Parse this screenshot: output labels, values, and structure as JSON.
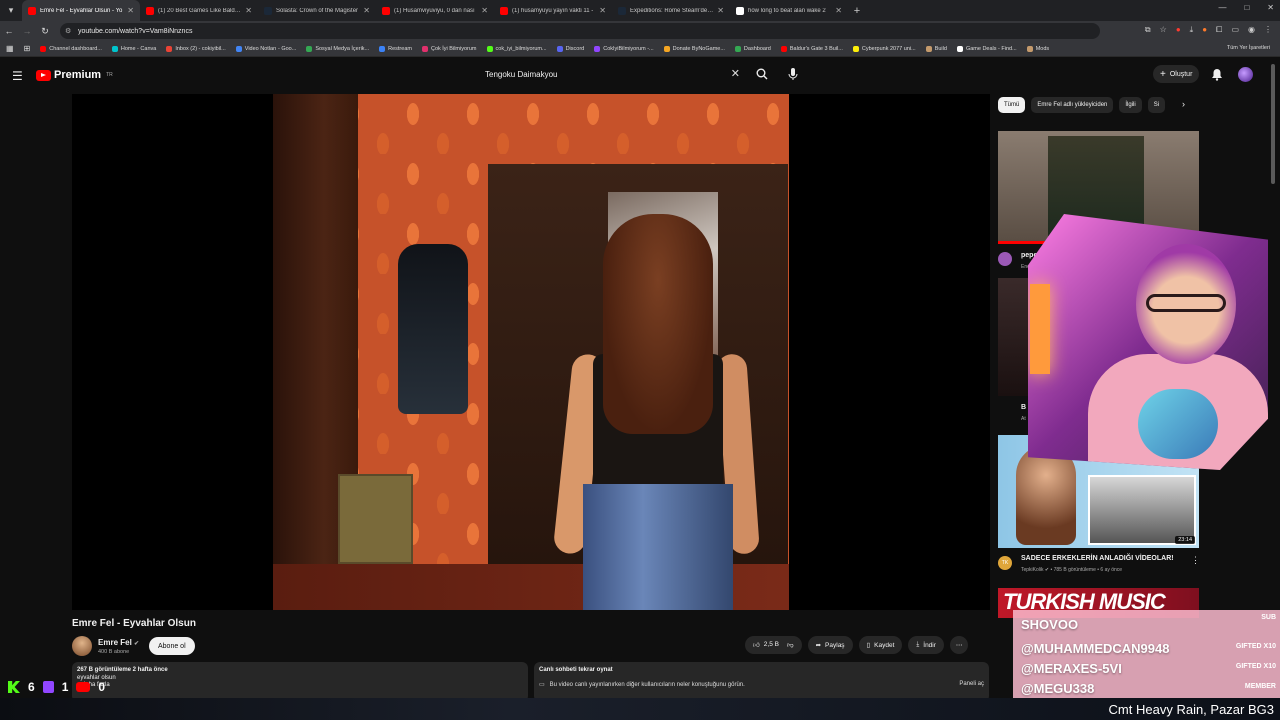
{
  "browser": {
    "tabs": [
      {
        "title": "Emre Fel - Eyvahlar Olsun - Yo",
        "color": "#ff0000",
        "active": true
      },
      {
        "title": "(1) 20 Best Games Like Baldur's",
        "color": "#ff0000"
      },
      {
        "title": "Solasta: Crown of the Magister",
        "color": "#1b2838"
      },
      {
        "title": "(1) Husamviyuviyu, 0 dan nası",
        "color": "#ff0000"
      },
      {
        "title": "(1) husamyuyu yayın vakti 11 -",
        "color": "#ff0000"
      },
      {
        "title": "Expeditions: Rome Steam'de %",
        "color": "#1b2838"
      },
      {
        "title": "how long to beat alan wake 2",
        "color": "#ffffff"
      }
    ],
    "url": "youtube.com/watch?v=Vam8iNnzncs",
    "bookmarks": [
      {
        "label": "Channel dashboard...",
        "color": "#ff0000"
      },
      {
        "label": "Home - Canva",
        "color": "#00c4cc"
      },
      {
        "label": "Inbox (2) - cokiyibil...",
        "color": "#ea4335"
      },
      {
        "label": "Video Notları - Goo...",
        "color": "#4285f4"
      },
      {
        "label": "Sosyal Medya İçerik...",
        "color": "#34a853"
      },
      {
        "label": "Restream",
        "color": "#3b82f6"
      },
      {
        "label": "Çok İyi Bilmiyorum",
        "color": "#e1306c"
      },
      {
        "label": "cok_iyi_bilmiyorum...",
        "color": "#53fc18"
      },
      {
        "label": "Discord",
        "color": "#5865f2"
      },
      {
        "label": "CokIyiBilmiyorum -...",
        "color": "#9146ff"
      },
      {
        "label": "Donate ByNoGame...",
        "color": "#f5a623"
      },
      {
        "label": "Dashboard",
        "color": "#34a853"
      },
      {
        "label": "Baldur's Gate 3 Buil...",
        "color": "#ff0000"
      },
      {
        "label": "Cyberpunk 2077 uni...",
        "color": "#fcee0a"
      },
      {
        "label": "Build",
        "color": "#c49a6c"
      },
      {
        "label": "Game Deals - Find...",
        "color": "#ffffff"
      },
      {
        "label": "Mods",
        "color": "#c49a6c"
      }
    ],
    "all_bookmarks": "Tüm Yer İşaretleri"
  },
  "youtube": {
    "logo": "Premium",
    "logo_region": "TR",
    "search_value": "Tengoku Daimakyou",
    "create_label": "Oluştur",
    "video": {
      "title": "Emre Fel - Eyvahlar Olsun",
      "channel": "Emre Fel",
      "subscribers": "400 B abone",
      "subscribe_label": "Abone ol",
      "likes": "2,5 B",
      "share": "Paylaş",
      "save": "Kaydet",
      "download": "İndir",
      "views_date": "267 B görüntüleme  2 hafta önce",
      "desc_line": "eyvahlar olsun",
      "more": "...daha fazla"
    },
    "live_chat": {
      "title": "Canlı sohbeti tekrar oynat",
      "text": "Bu video canlı yayınlanırken diğer kullanıcıların neler konuştuğunu görün.",
      "button": "Paneli aç"
    },
    "chips": [
      {
        "label": "Tümü",
        "active": true
      },
      {
        "label": "Emre Fel adlı yükleyiciden"
      },
      {
        "label": "İlgili"
      },
      {
        "label": "Si"
      }
    ],
    "recommendations": [
      {
        "title": "pepee iki ekm",
        "channel": "Enes Dem"
      },
      {
        "title": "B",
        "channel": "At"
      },
      {
        "title": "SADECE ERKEKLERİN ANLADIĞI VİDEOLAR!",
        "channel": "TepkiKolik",
        "meta": "785 B görüntüleme • 6 ay önce",
        "duration": "23:14",
        "badge": "TK"
      },
      {
        "title": "TURKISH MUSIC"
      }
    ]
  },
  "stream_overlay": {
    "sub_label": "SUB",
    "events": [
      {
        "name": "SHOVOO",
        "tag": ""
      },
      {
        "name": "@MUHAMMEDCAN9948",
        "tag": "GIFTED X10"
      },
      {
        "name": "@MERAXES-5VI",
        "tag": "GIFTED X10"
      },
      {
        "name": "@MEGU338",
        "tag": "MEMBER"
      }
    ],
    "kick_count": "6",
    "twitch_count": "1",
    "youtube_count": "0",
    "ticker": "Cmt Heavy Rain, Pazar BG3"
  }
}
